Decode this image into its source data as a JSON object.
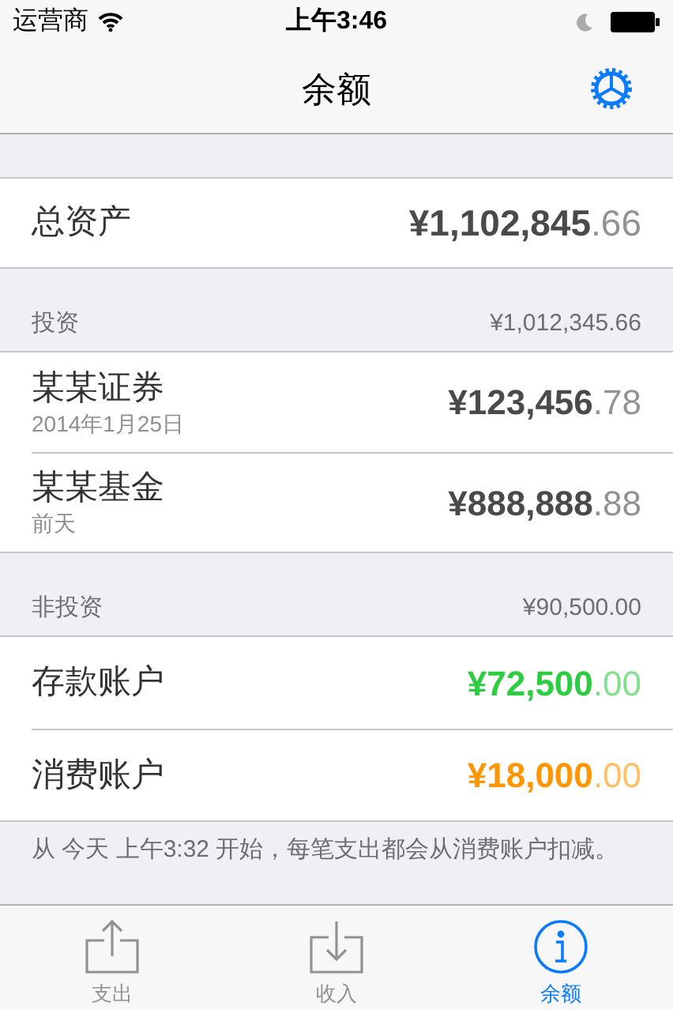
{
  "status_bar": {
    "carrier": "运营商",
    "time": "上午3:46"
  },
  "nav": {
    "title": "余额"
  },
  "total": {
    "label": "总资产",
    "currency": "¥",
    "main": "1,102,845",
    "cents": ".66",
    "color": "#4a4a4a"
  },
  "sections": [
    {
      "title": "投资",
      "sum": "¥1,012,345.66",
      "rows": [
        {
          "name": "某某证券",
          "subtitle": "2014年1月25日",
          "currency": "¥",
          "main": "123,456",
          "cents": ".78",
          "color": "#4a4a4a"
        },
        {
          "name": "某某基金",
          "subtitle": "前天",
          "currency": "¥",
          "main": "888,888",
          "cents": ".88",
          "color": "#4a4a4a"
        }
      ]
    },
    {
      "title": "非投资",
      "sum": "¥90,500.00",
      "rows": [
        {
          "name": "存款账户",
          "currency": "¥",
          "main": "72,500",
          "cents": ".00",
          "color": "#2ecc40"
        },
        {
          "name": "消费账户",
          "currency": "¥",
          "main": "18,000",
          "cents": ".00",
          "color": "#ff9500"
        }
      ]
    }
  ],
  "footnote": "从 今天 上午3:32 开始，每笔支出都会从消费账户扣减。",
  "tabs": [
    {
      "label": "支出",
      "kind": "out",
      "selected": false
    },
    {
      "label": "收入",
      "kind": "in",
      "selected": false
    },
    {
      "label": "余额",
      "kind": "info",
      "selected": true
    }
  ]
}
